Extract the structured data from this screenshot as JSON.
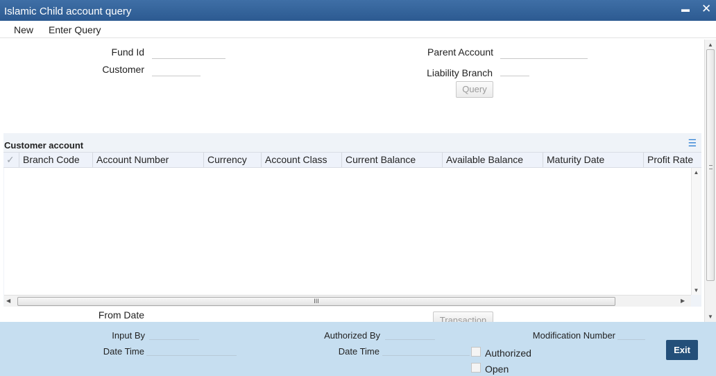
{
  "window": {
    "title": "Islamic Child account query",
    "minimize": "▬",
    "close": "✕"
  },
  "menu": {
    "new": "New",
    "enter_query": "Enter Query"
  },
  "form": {
    "fund_id_label": "Fund Id",
    "customer_label": "Customer",
    "parent_account_label": "Parent Account",
    "liability_branch_label": "Liability Branch",
    "query_button": "Query",
    "from_date_label": "From Date",
    "transaction_button": "Transaction"
  },
  "grid": {
    "title": "Customer account",
    "columns": [
      "Branch Code",
      "Account Number",
      "Currency",
      "Account Class",
      "Current Balance",
      "Available Balance",
      "Maturity Date",
      "Profit Rate"
    ],
    "rows": [],
    "scroll_grip": "III"
  },
  "footer": {
    "input_by_label": "Input By",
    "date_time_label": "Date Time",
    "authorized_by_label": "Authorized By",
    "date_time_label_2": "Date Time",
    "modification_number_label": "Modification Number",
    "authorized_label": "Authorized",
    "open_label": "Open",
    "exit_button": "Exit"
  },
  "colors": {
    "title_bar": "#2c5a91",
    "footer_bg": "#c6def0",
    "exit_bg": "#244f79",
    "section_bg": "#eff3f8"
  }
}
